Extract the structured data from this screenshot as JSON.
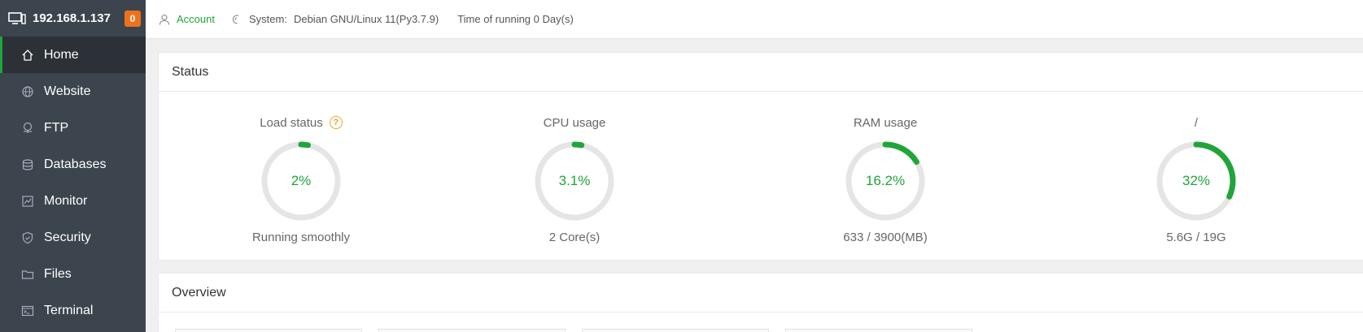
{
  "sidebar": {
    "ip": "192.168.1.137",
    "badge": "0",
    "items": [
      {
        "label": "Home",
        "icon": "home-icon"
      },
      {
        "label": "Website",
        "icon": "globe-icon"
      },
      {
        "label": "FTP",
        "icon": "ftp-icon"
      },
      {
        "label": "Databases",
        "icon": "database-icon"
      },
      {
        "label": "Monitor",
        "icon": "monitor-chart-icon"
      },
      {
        "label": "Security",
        "icon": "shield-icon"
      },
      {
        "label": "Files",
        "icon": "folder-icon"
      },
      {
        "label": "Terminal",
        "icon": "terminal-icon"
      }
    ]
  },
  "topbar": {
    "account": "Account",
    "system_label": "System:",
    "system_value": "Debian GNU/Linux 11(Py3.7.9)",
    "uptime": "Time of running 0 Day(s)"
  },
  "status": {
    "title": "Status",
    "gauges": [
      {
        "title": "Load status",
        "value": "2%",
        "percent": 2,
        "sub": "Running smoothly",
        "help": "?"
      },
      {
        "title": "CPU usage",
        "value": "3.1%",
        "percent": 3.1,
        "sub": "2 Core(s)"
      },
      {
        "title": "RAM usage",
        "value": "16.2%",
        "percent": 16.2,
        "sub": "633 / 3900(MB)"
      },
      {
        "title": "/",
        "value": "32%",
        "percent": 32,
        "sub": "5.6G / 19G"
      }
    ]
  },
  "overview": {
    "title": "Overview"
  },
  "colors": {
    "accent": "#20a53a",
    "sidebar": "#3c444d",
    "badge": "#f0711c",
    "help": "#f0a02a",
    "track": "#e5e5e5"
  }
}
